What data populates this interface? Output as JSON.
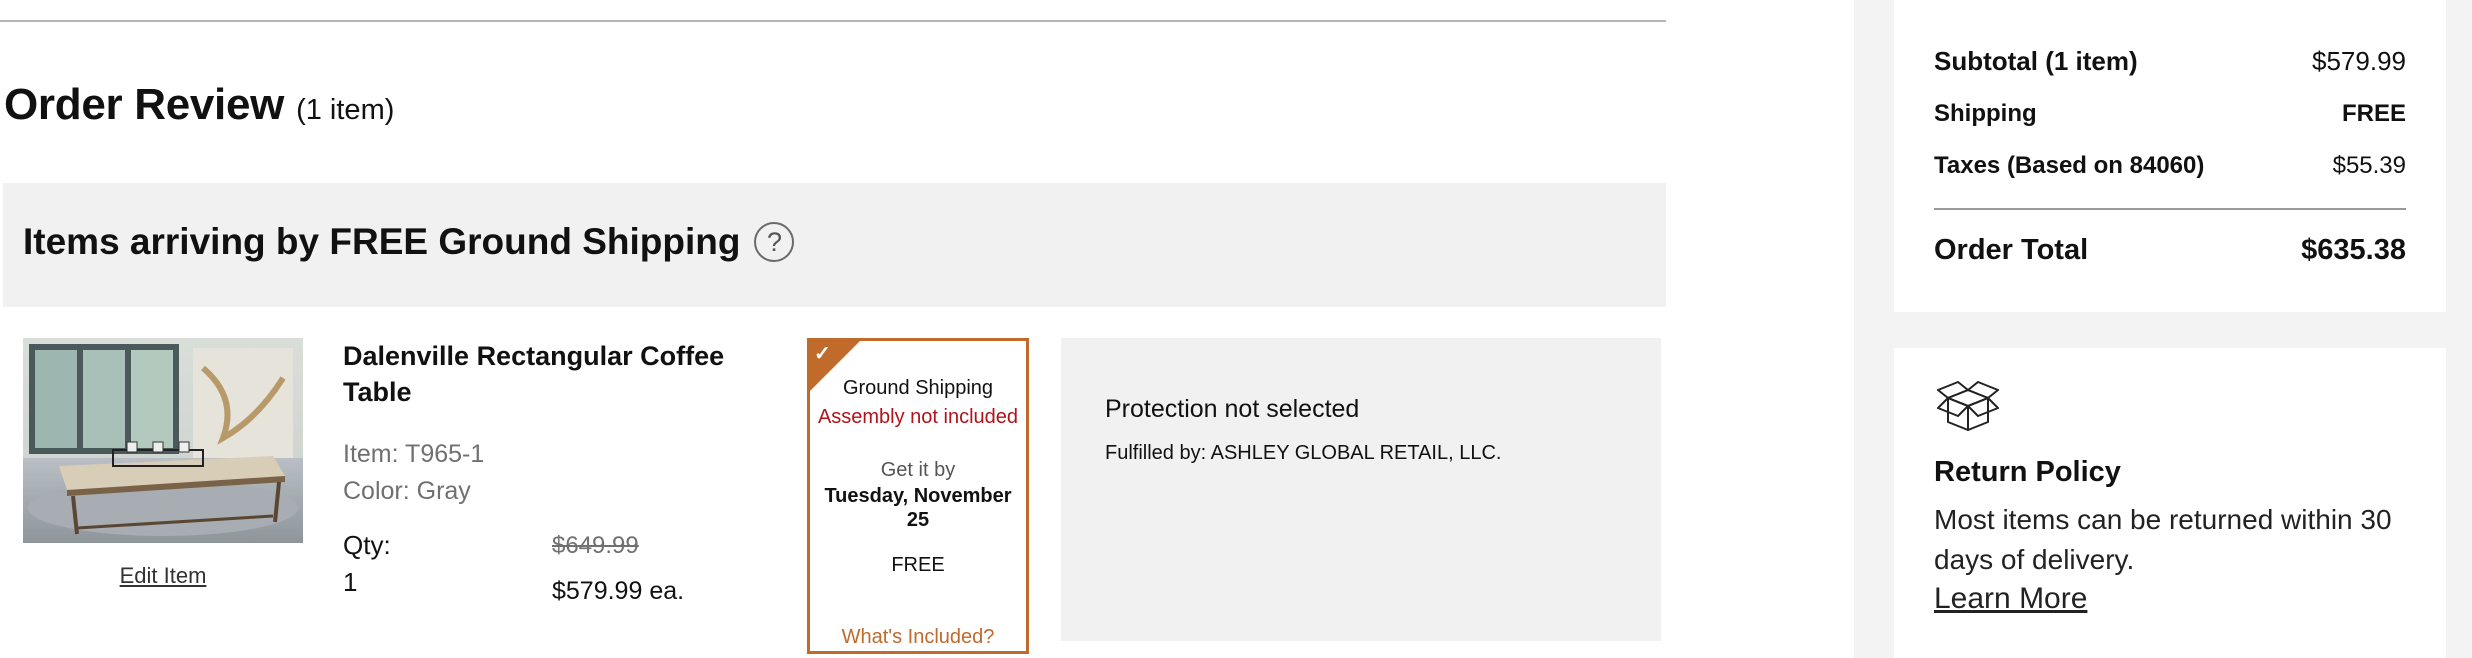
{
  "order_review": {
    "title": "Order Review",
    "item_count": "(1 item)"
  },
  "shipping_group": {
    "title": "Items arriving by FREE Ground Shipping",
    "help_icon": "question-circle-icon"
  },
  "product": {
    "name": "Dalenville Rectangular Coffee Table",
    "item_number": "Item: T965-1",
    "color": "Color: Gray",
    "qty_label": "Qty:",
    "qty_value": "1",
    "original_price": "$649.99",
    "price": "$579.99 ea.",
    "edit_label": "Edit Item"
  },
  "shipping_option": {
    "method": "Ground Shipping",
    "assembly": "Assembly not included",
    "get_it_by": "Get it by",
    "delivery_date": "Tuesday, November 25",
    "cost": "FREE",
    "whats_included": "What's Included?",
    "selected_icon": "checkmark-icon",
    "accent_color": "#c06a2c"
  },
  "protection": {
    "status": "Protection not selected",
    "fulfilled_by": "Fulfilled by: ASHLEY GLOBAL RETAIL, LLC."
  },
  "summary": {
    "subtotal_label": "Subtotal (1 item)",
    "subtotal_value": "$579.99",
    "shipping_label": "Shipping",
    "shipping_value": "FREE",
    "taxes_label": "Taxes (Based on 84060)",
    "taxes_value": "$55.39",
    "total_label": "Order Total",
    "total_value": "$635.38"
  },
  "return_policy": {
    "icon": "box-icon",
    "title": "Return Policy",
    "description": "Most items can be returned within 30 days of delivery.",
    "link": "Learn More"
  },
  "colors": {
    "error_red": "#b0131a",
    "panel_gray": "#f1f1f1"
  }
}
